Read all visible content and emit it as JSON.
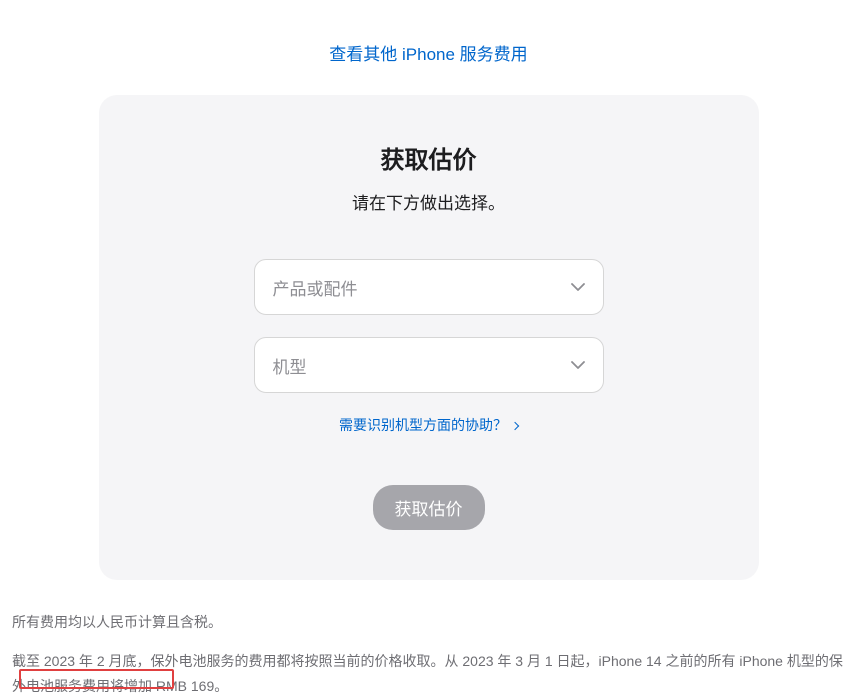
{
  "top_link": "查看其他 iPhone 服务费用",
  "card": {
    "title": "获取估价",
    "subtitle": "请在下方做出选择。",
    "product_placeholder": "产品或配件",
    "model_placeholder": "机型",
    "help_link": "需要识别机型方面的协助？",
    "button_label": "获取估价"
  },
  "notes": {
    "line1": "所有费用均以人民币计算且含税。",
    "line2": "截至 2023 年 2 月底，保外电池服务的费用都将按照当前的价格收取。从 2023 年 3 月 1 日起，iPhone 14 之前的所有 iPhone 机型的保外电池服务费用将增加 RMB 169。"
  }
}
